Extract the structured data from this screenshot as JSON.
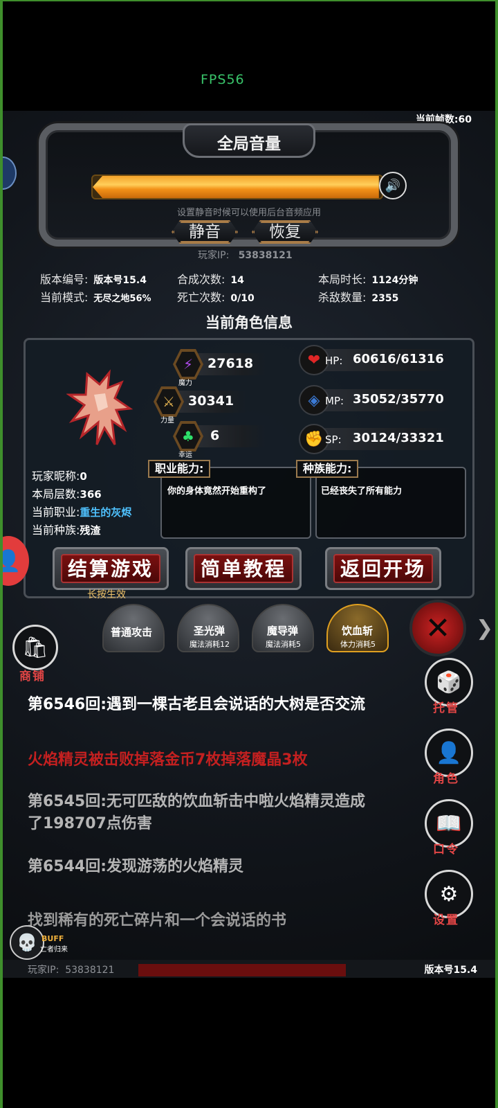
{
  "status": {
    "fps": "FPS56",
    "frame_count": "当前帧数:60"
  },
  "volume": {
    "title": "全局音量",
    "level": 0.99,
    "hint": "设置静音时候可以使用后台音频应用",
    "mute_label": "静音",
    "restore_label": "恢复"
  },
  "player_ip": {
    "label": "玩家IP:",
    "value": "53838121"
  },
  "stats": {
    "version": {
      "label": "版本编号:",
      "value": "版本号15.4"
    },
    "mode": {
      "label": "当前模式:",
      "value": "无尽之地56%"
    },
    "synth": {
      "label": "合成次数:",
      "value": "14"
    },
    "deaths": {
      "label": "死亡次数:",
      "value": "0/10"
    },
    "duration": {
      "label": "本局时长:",
      "value": "1124分钟"
    },
    "kills": {
      "label": "杀敌数量:",
      "value": "2355"
    }
  },
  "character": {
    "section_title": "当前角色信息",
    "magic": {
      "value": "27618",
      "label": "魔力"
    },
    "strength": {
      "value": "30341",
      "label": "力量"
    },
    "luck": {
      "value": "6",
      "label": "幸运"
    },
    "hp": {
      "label": "HP:",
      "value": "60616/61316"
    },
    "mp": {
      "label": "MP:",
      "value": "35052/35770"
    },
    "sp": {
      "label": "SP:",
      "value": "30124/33321"
    },
    "nickname": {
      "label": "玩家昵称:",
      "value": "0"
    },
    "floors": {
      "label": "本局层数:",
      "value": "366"
    },
    "job": {
      "label": "当前职业:",
      "value": "重生的灰烬"
    },
    "race": {
      "label": "当前种族:",
      "value": "残渣"
    },
    "job_ability": {
      "tag": "职业能力:",
      "text": "你的身体竟然开始重构了"
    },
    "race_ability": {
      "tag": "种族能力:",
      "text": "已经丧失了所有能力"
    }
  },
  "buttons": {
    "settle": "结算游戏",
    "settle_hint": "长按生效",
    "tutorial": "简单教程",
    "back": "返回开场"
  },
  "skills": [
    {
      "name": "普通攻击",
      "cost": ""
    },
    {
      "name": "圣光弹",
      "cost": "魔法消耗12"
    },
    {
      "name": "魔导弹",
      "cost": "魔法消耗5"
    },
    {
      "name": "饮血斩",
      "cost": "体力消耗5"
    }
  ],
  "side_menu": {
    "shop": "商铺",
    "auto": "托管",
    "role": "角色",
    "code": "口令",
    "settings": "设置"
  },
  "log": [
    {
      "text": "第6546回:遇到一棵古老且会说话的大树是否交流",
      "color": "#ffffff"
    },
    {
      "text": "火焰精灵被击败掉落金币7枚掉落魔晶3枚",
      "color": "#c42020"
    },
    {
      "text": "第6545回:无可匹敌的饮血斩击中啦火焰精灵造成",
      "color": "#b5b5b5"
    },
    {
      "text": "了198707点伤害",
      "color": "#b5b5b5"
    },
    {
      "text": "第6544回:发现游荡的火焰精灵",
      "color": "#b5b5b5"
    },
    {
      "text": "找到稀有的死亡碎片和一个会说话的书",
      "color": "#9a9a9a"
    }
  ],
  "buff": {
    "title": "BUFF",
    "subtitle": "亡者归来"
  },
  "footer": {
    "ip_label": "玩家IP:",
    "ip_value": "53838121",
    "version": "版本号15.4"
  },
  "colors": {
    "accent_gold": "#f3a22a",
    "danger_red": "#c42020",
    "job_cyan": "#4fc2ff"
  }
}
